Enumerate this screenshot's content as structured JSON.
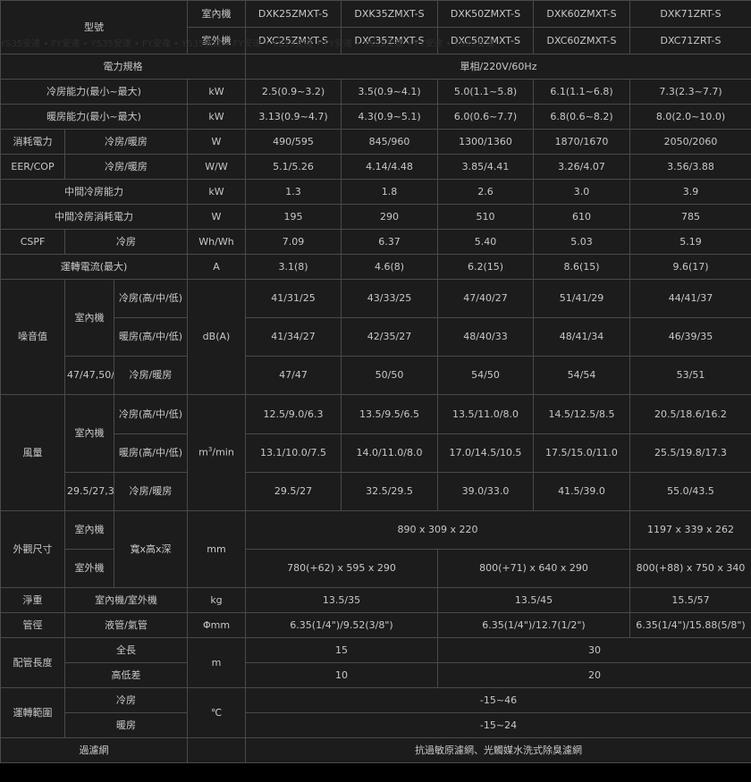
{
  "watermark": "YS35安達 • FY安達 • YS35安達 • FY安達 • YS35安達 • FY安達 • YS35安達 • FY安達 • YS35安達 • FY安達 • YS35安達",
  "header": {
    "model_label": "型號",
    "indoor_label": "室內機",
    "outdoor_label": "室外機",
    "indoor_models": [
      "DXK25ZMXT-S",
      "DXK35ZMXT-S",
      "DXK50ZMXT-S",
      "DXK60ZMXT-S",
      "DXK71ZRT-S"
    ],
    "outdoor_models": [
      "DXC25ZMXT-S",
      "DXC35ZMXT-S",
      "DXC50ZMXT-S",
      "DXC60ZMXT-S",
      "DXC71ZRT-S"
    ]
  },
  "power": {
    "label": "電力規格",
    "value": "單相/220V/60Hz"
  },
  "cooling_capacity": {
    "label": "冷房能力(最小~最大)",
    "unit": "kW",
    "values": [
      "2.5(0.9~3.2)",
      "3.5(0.9~4.1)",
      "5.0(1.1~5.8)",
      "6.1(1.1~6.8)",
      "7.3(2.3~7.7)"
    ]
  },
  "heating_capacity": {
    "label": "暖房能力(最小~最大)",
    "unit": "kW",
    "values": [
      "3.13(0.9~4.7)",
      "4.3(0.9~5.1)",
      "6.0(0.6~7.7)",
      "6.8(0.6~8.2)",
      "8.0(2.0~10.0)"
    ]
  },
  "power_consumption": {
    "label": "消耗電力",
    "sub": "冷房/暖房",
    "unit": "W",
    "values": [
      "490/595",
      "845/960",
      "1300/1360",
      "1870/1670",
      "2050/2060"
    ]
  },
  "eer": {
    "label": "EER/COP",
    "sub": "冷房/暖房",
    "unit": "W/W",
    "values": [
      "5.1/5.26",
      "4.14/4.48",
      "3.85/4.41",
      "3.26/4.07",
      "3.56/3.88"
    ]
  },
  "mid_cooling": {
    "label": "中間冷房能力",
    "unit": "kW",
    "values": [
      "1.3",
      "1.8",
      "2.6",
      "3.0",
      "3.9"
    ]
  },
  "mid_power": {
    "label": "中間冷房消耗電力",
    "unit": "W",
    "values": [
      "195",
      "290",
      "510",
      "610",
      "785"
    ]
  },
  "cspf": {
    "label": "CSPF",
    "sub": "冷房",
    "unit": "Wh/Wh",
    "values": [
      "7.09",
      "6.37",
      "5.40",
      "5.03",
      "5.19"
    ]
  },
  "current": {
    "label": "運轉電流(最大)",
    "unit": "A",
    "values": [
      "3.1(8)",
      "4.6(8)",
      "6.2(15)",
      "8.6(15)",
      "9.6(17)"
    ]
  },
  "noise": {
    "label": "噪音值",
    "unit": "dB(A)",
    "indoor": "室內機",
    "outdoor": [
      "47/47",
      "50/50",
      "54/50",
      "54/54",
      "53/51"
    ],
    "cool_hml": "冷房(高/中/低)",
    "heat_hml": "暖房(高/中/低)",
    "cool_heat": "冷房/暖房",
    "indoor_cool": [
      "41/31/25",
      "43/33/25",
      "47/40/27",
      "51/41/29",
      "44/41/37"
    ],
    "indoor_heat": [
      "41/34/27",
      "42/35/27",
      "48/40/33",
      "48/41/34",
      "46/39/35"
    ]
  },
  "airflow": {
    "label": "風量",
    "unit_base": "m",
    "unit_sup": "3",
    "unit_tail": "/min",
    "indoor": "室內機",
    "outdoor": [
      "29.5/27",
      "32.5/29.5",
      "39.0/33.0",
      "41.5/39.0",
      "55.0/43.5"
    ],
    "cool_hml": "冷房(高/中/低)",
    "heat_hml": "暖房(高/中/低)",
    "cool_heat": "冷房/暖房",
    "indoor_cool": [
      "12.5/9.0/6.3",
      "13.5/9.5/6.5",
      "13.5/11.0/8.0",
      "14.5/12.5/8.5",
      "20.5/18.6/16.2"
    ],
    "indoor_heat": [
      "13.1/10.0/7.5",
      "14.0/11.0/8.0",
      "17.0/14.5/10.5",
      "17.5/15.0/11.0",
      "25.5/19.8/17.3"
    ]
  },
  "dimensions": {
    "label": "外觀尺寸",
    "indoor": "室內機",
    "outdoor": "室外機",
    "sub": "寬x高x深",
    "unit": "mm",
    "indoor_a": "890 x 309 x 220",
    "indoor_b": "1197 x 339 x 262",
    "outdoor_a": "780(+62) x 595 x 290",
    "outdoor_b": "800(+71) x 640 x 290",
    "outdoor_c": "800(+88) x 750 x 340"
  },
  "weight": {
    "label": "淨重",
    "sub": "室內機/室外機",
    "unit": "kg",
    "a": "13.5/35",
    "b": "13.5/45",
    "c": "15.5/57"
  },
  "pipe": {
    "label": "管徑",
    "sub": "液管/氣管",
    "unit": "Φmm",
    "a": "6.35(1/4\")/9.52(3/8\")",
    "b": "6.35(1/4\")/12.7(1/2\")",
    "c": "6.35(1/4\")/15.88(5/8\")"
  },
  "pipe_length": {
    "label": "配管長度",
    "unit": "m",
    "total_label": "全長",
    "height_label": "高低差",
    "total_a": "15",
    "total_b": "30",
    "height_a": "10",
    "height_b": "20"
  },
  "operating_range": {
    "label": "運轉範圍",
    "unit": "℃",
    "cool_label": "冷房",
    "heat_label": "暖房",
    "cool": "-15~46",
    "heat": "-15~24"
  },
  "filter": {
    "label": "過濾網",
    "value": "抗過敏原濾網、光觸媒水洗式除臭濾網"
  }
}
